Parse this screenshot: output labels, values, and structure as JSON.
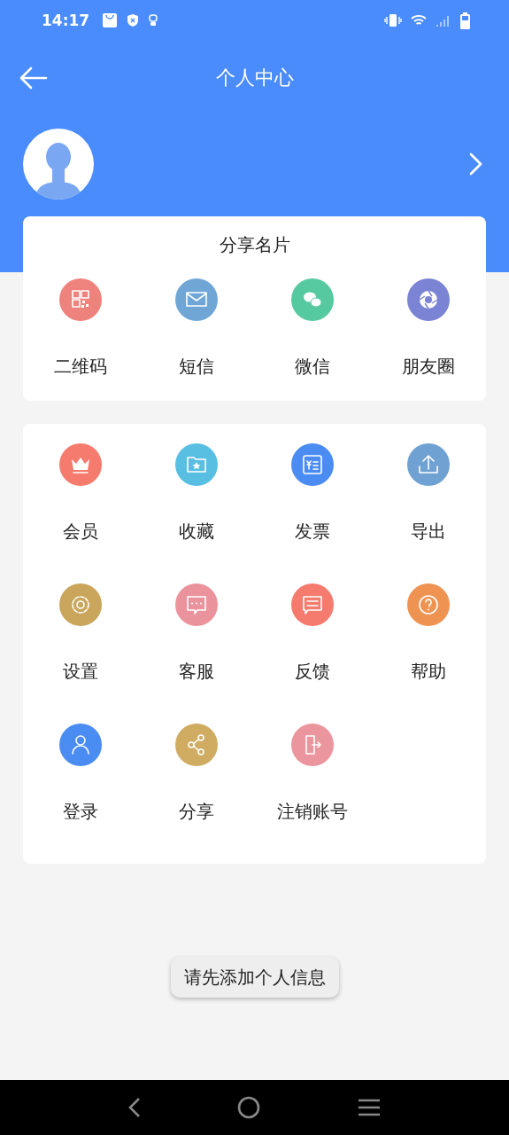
{
  "status_bar": {
    "time": "14:17"
  },
  "header": {
    "title": "个人中心"
  },
  "share_card": {
    "title": "分享名片",
    "items": [
      {
        "label": "二维码",
        "color": "#ee837d"
      },
      {
        "label": "短信",
        "color": "#6fa6d6"
      },
      {
        "label": "微信",
        "color": "#56c9a1"
      },
      {
        "label": "朋友圈",
        "color": "#7b84d4"
      }
    ]
  },
  "menu_card": {
    "items": [
      {
        "label": "会员",
        "color": "#f47b6e"
      },
      {
        "label": "收藏",
        "color": "#58bfe3"
      },
      {
        "label": "发票",
        "color": "#4a8cf2"
      },
      {
        "label": "导出",
        "color": "#6fa2d2"
      },
      {
        "label": "设置",
        "color": "#c9a65c"
      },
      {
        "label": "客服",
        "color": "#eb939c"
      },
      {
        "label": "反馈",
        "color": "#f47b6e"
      },
      {
        "label": "帮助",
        "color": "#ee9352"
      },
      {
        "label": "登录",
        "color": "#4a8cf2"
      },
      {
        "label": "分享",
        "color": "#cfac62"
      },
      {
        "label": "注销账号",
        "color": "#eb959e"
      }
    ]
  },
  "toast": {
    "text": "请先添加个人信息"
  }
}
